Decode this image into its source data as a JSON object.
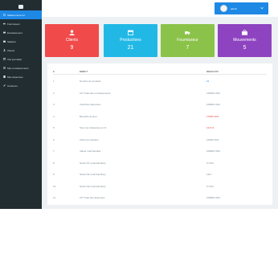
{
  "sidebar": {
    "items": [
      {
        "label": "Tableau de bord",
        "icon": "dashboard-icon",
        "active": true
      },
      {
        "label": "Fournisseur",
        "icon": "truck-icon",
        "active": false
      },
      {
        "label": "Encaissement",
        "icon": "cash-icon",
        "active": false
      },
      {
        "label": "Salaires",
        "icon": "wallet-icon",
        "active": false
      },
      {
        "label": "Clients",
        "icon": "user-icon",
        "active": false
      },
      {
        "label": "Voir journalier",
        "icon": "calendar-icon",
        "active": false
      },
      {
        "label": "Mes encaissements",
        "icon": "list-icon",
        "active": false
      },
      {
        "label": "Mes dépenses",
        "icon": "receipt-icon",
        "active": false
      },
      {
        "label": "Créances",
        "icon": "edit-icon",
        "active": false
      }
    ]
  },
  "topbar": {
    "user_label": "admin"
  },
  "cards": [
    {
      "label": "Clients",
      "value": "9",
      "color": "#f04a4a",
      "icon": "user-icon"
    },
    {
      "label": "Productions",
      "value": "21",
      "color": "#22b8e6",
      "icon": "calendar-icon"
    },
    {
      "label": "Fournisseur",
      "value": "7",
      "color": "#8bc34a",
      "icon": "truck-icon"
    },
    {
      "label": "Mouvements",
      "value": "5",
      "color": "#8e44c0",
      "icon": "briefcase-icon"
    }
  ],
  "table": {
    "headers": [
      "#",
      "DEBUT",
      "RESULTAT"
    ],
    "rows": [
      {
        "num": "1",
        "label": "Nombre de produits",
        "result": "21",
        "tone": "blue"
      },
      {
        "num": "2",
        "label": "CtT Total des encaissements",
        "result": "125000 CDC",
        "tone": "gray"
      },
      {
        "num": "3",
        "label": "Total Des dépenses",
        "result": "108000 CDC",
        "tone": "gray"
      },
      {
        "num": "4",
        "label": "Benefice annuel",
        "result": "17000 CDC",
        "tone": "red"
      },
      {
        "num": "5",
        "label": "Taux de croissance en %",
        "result": "13.6 %",
        "tone": "red"
      },
      {
        "num": "6",
        "label": "Total commandes",
        "result": "10000 CDC",
        "tone": "gray"
      },
      {
        "num": "7",
        "label": "Valeur marchandise",
        "result": "108000 CDC",
        "tone": "gray"
      },
      {
        "num": "8",
        "label": "Stock CK (marchandise)",
        "result": "0 CDC",
        "tone": "gray"
      },
      {
        "num": "9",
        "label": "Stock CE (marchandise)",
        "result": "140 l",
        "tone": "gray"
      },
      {
        "num": "10",
        "label": "Stock CE (marchandise)",
        "result": "0 CDC",
        "tone": "gray"
      },
      {
        "num": "11",
        "label": "CtT Total des dépenses",
        "result": "108000 CDC",
        "tone": "gray"
      }
    ]
  }
}
